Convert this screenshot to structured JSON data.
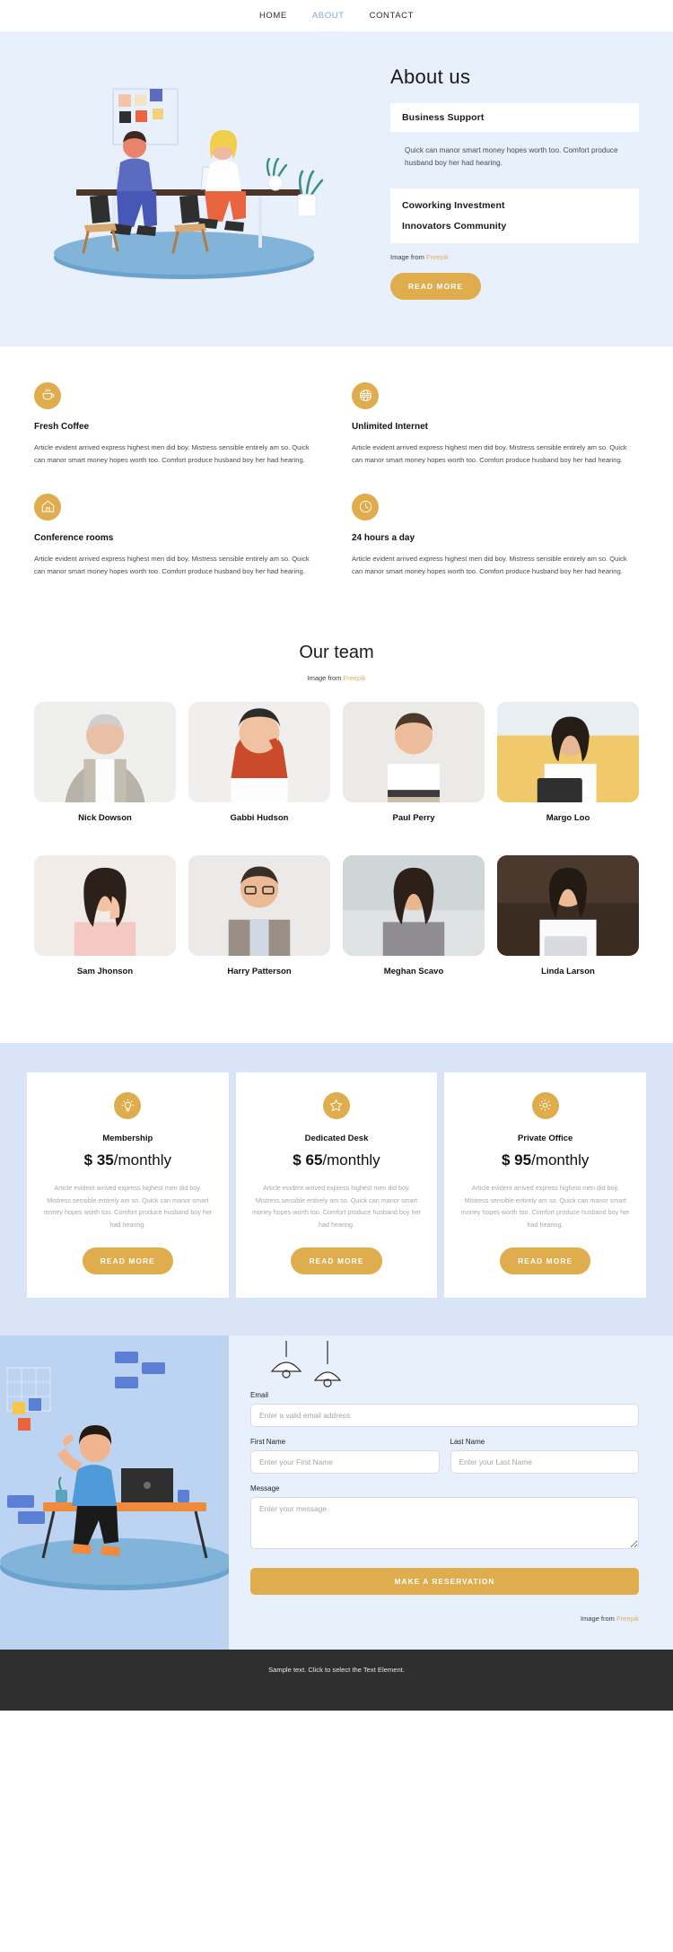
{
  "nav": {
    "items": [
      {
        "label": "HOME",
        "active": false
      },
      {
        "label": "ABOUT",
        "active": true
      },
      {
        "label": "CONTACT",
        "active": false
      }
    ]
  },
  "hero": {
    "title": "About us",
    "accordion": [
      {
        "title": "Business Support",
        "body": "Quick can manor smart money hopes worth too. Comfort produce husband boy her had hearing.",
        "open": true
      },
      {
        "title": "Coworking Investment",
        "body": "",
        "open": false
      },
      {
        "title": "Innovators Community",
        "body": "",
        "open": false
      }
    ],
    "credit_prefix": "Image from ",
    "credit_link": "Freepik",
    "button": "READ MORE"
  },
  "features": [
    {
      "icon": "coffee-cup-icon",
      "title": "Fresh Coffee",
      "text": "Article evident arrived express highest men did boy. Mistress sensible entirely am so. Quick can manor smart money hopes worth too. Comfort produce husband boy her had hearing."
    },
    {
      "icon": "globe-icon",
      "title": "Unlimited Internet",
      "text": "Article evident arrived express highest men did boy. Mistress sensible entirely am so. Quick can manor smart money hopes worth too. Comfort produce husband boy her had hearing."
    },
    {
      "icon": "home-icon",
      "title": "Conference rooms",
      "text": "Article evident arrived express highest men did boy. Mistress sensible entirely am so. Quick can manor smart money hopes worth too. Comfort produce husband boy her had hearing."
    },
    {
      "icon": "clock-icon",
      "title": "24 hours a day",
      "text": "Article evident arrived express highest men did boy. Mistress sensible entirely am so. Quick can manor smart money hopes worth too. Comfort produce husband boy her had hearing."
    }
  ],
  "team": {
    "title": "Our team",
    "credit_prefix": "Image from ",
    "credit_link": "Freepik",
    "members": [
      {
        "name": "Nick Dowson"
      },
      {
        "name": "Gabbi Hudson"
      },
      {
        "name": "Paul Perry"
      },
      {
        "name": "Margo Loo"
      },
      {
        "name": "Sam Jhonson"
      },
      {
        "name": "Harry Patterson"
      },
      {
        "name": "Meghan Scavo"
      },
      {
        "name": "Linda Larson"
      }
    ]
  },
  "pricing": {
    "cards": [
      {
        "icon": "lightbulb-icon",
        "name": "Membership",
        "currency": "$",
        "amount": "35",
        "period": "/monthly",
        "text": "Article evident arrived express highest men did boy. Mistress sensible entirely am so. Quick can manor smart money hopes worth too. Comfort produce husband boy her had hearing.",
        "button": "READ MORE"
      },
      {
        "icon": "star-icon",
        "name": "Dedicated Desk",
        "currency": "$",
        "amount": "65",
        "period": "/monthly",
        "text": "Article evident arrived express highest men did boy. Mistress sensible entirely am so. Quick can manor smart money hopes worth too. Comfort produce husband boy her had hearing.",
        "button": "READ MORE"
      },
      {
        "icon": "gear-icon",
        "name": "Private Office",
        "currency": "$",
        "amount": "95",
        "period": "/monthly",
        "text": "Article evident arrived express highest men did boy. Mistress sensible entirely am so. Quick can manor smart money hopes worth too. Comfort produce husband boy her had hearing.",
        "button": "READ MORE"
      }
    ]
  },
  "contact": {
    "email_label": "Email",
    "email_placeholder": "Enter a valid email address",
    "email_value": "",
    "first_name_label": "First Name",
    "first_name_placeholder": "Enter your First Name",
    "first_name_value": "",
    "last_name_label": "Last Name",
    "last_name_placeholder": "Enter your Last Name",
    "last_name_value": "",
    "message_label": "Message",
    "message_placeholder": "Enter your message",
    "message_value": "",
    "submit": "MAKE A RESERVATION",
    "credit_prefix": "Image from ",
    "credit_link": "Freepik"
  },
  "footer": {
    "text": "Sample text. Click to select the Text Element."
  },
  "colors": {
    "accent": "#e0ad4e",
    "hero_bg": "#e8f0fb",
    "pricing_bg": "#d9e5f7",
    "nav_active": "#7fa8cf",
    "footer_bg": "#2f2f2f"
  }
}
